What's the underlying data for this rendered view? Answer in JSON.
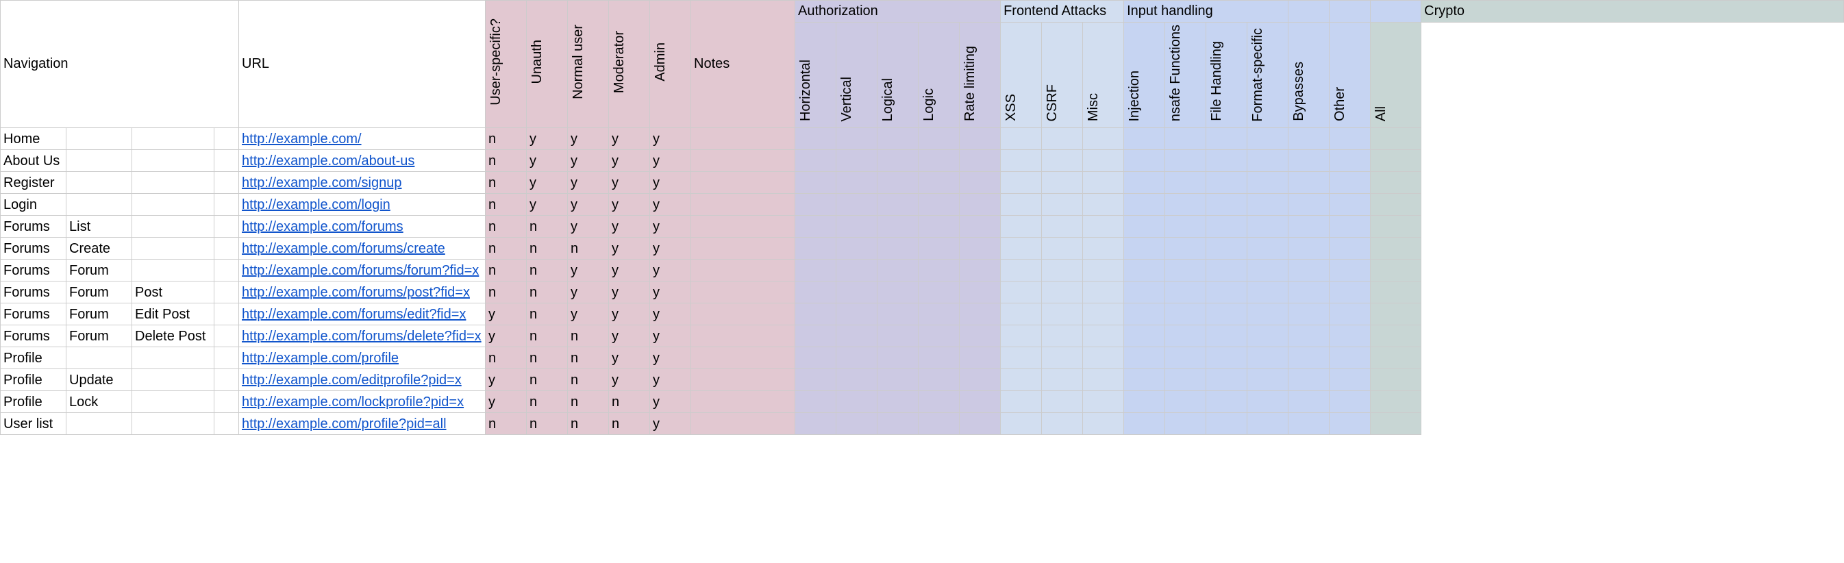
{
  "groups": {
    "authorization": "Authorization",
    "frontend": "Frontend Attacks",
    "input": "Input handling",
    "crypto": "Crypto"
  },
  "headers": {
    "navigation": "Navigation",
    "url": "URL",
    "user_specific": "User-specific?",
    "unauth": "Unauth",
    "normal_user": "Normal user",
    "moderator": "Moderator",
    "admin": "Admin",
    "notes": "Notes",
    "horizontal": "Horizontal",
    "vertical": "Vertical",
    "logical": "Logical",
    "logic": "Logic",
    "rate_limiting": "Rate limiting",
    "xss": "XSS",
    "csrf": "CSRF",
    "misc": "Misc",
    "injection": "Injection",
    "nsafe_functions": "nsafe Functions",
    "file_handling": "File Handling",
    "format_specific": "Format-specific",
    "bypasses": "Bypasses",
    "other": "Other",
    "all": "All"
  },
  "rows": [
    {
      "n0": "Home",
      "n1": "",
      "n2": "",
      "n3": "",
      "url": "http://example.com/",
      "us": "n",
      "ua": "y",
      "nu": "y",
      "mo": "y",
      "ad": "y"
    },
    {
      "n0": "About Us",
      "n1": "",
      "n2": "",
      "n3": "",
      "url": "http://example.com/about-us",
      "us": "n",
      "ua": "y",
      "nu": "y",
      "mo": "y",
      "ad": "y"
    },
    {
      "n0": "Register",
      "n1": "",
      "n2": "",
      "n3": "",
      "url": "http://example.com/signup",
      "us": "n",
      "ua": "y",
      "nu": "y",
      "mo": "y",
      "ad": "y"
    },
    {
      "n0": "Login",
      "n1": "",
      "n2": "",
      "n3": "",
      "url": "http://example.com/login",
      "us": "n",
      "ua": "y",
      "nu": "y",
      "mo": "y",
      "ad": "y"
    },
    {
      "n0": "Forums",
      "n1": "List",
      "n2": "",
      "n3": "",
      "url": "http://example.com/forums",
      "us": "n",
      "ua": "n",
      "nu": "y",
      "mo": "y",
      "ad": "y"
    },
    {
      "n0": "Forums",
      "n1": "Create",
      "n2": "",
      "n3": "",
      "url": "http://example.com/forums/create",
      "us": "n",
      "ua": "n",
      "nu": "n",
      "mo": "y",
      "ad": "y"
    },
    {
      "n0": "Forums",
      "n1": "Forum",
      "n2": "",
      "n3": "",
      "url": "http://example.com/forums/forum?fid=x",
      "us": "n",
      "ua": "n",
      "nu": "y",
      "mo": "y",
      "ad": "y"
    },
    {
      "n0": "Forums",
      "n1": "Forum",
      "n2": "Post",
      "n3": "",
      "url": "http://example.com/forums/post?fid=x",
      "us": "n",
      "ua": "n",
      "nu": "y",
      "mo": "y",
      "ad": "y"
    },
    {
      "n0": "Forums",
      "n1": "Forum",
      "n2": "Edit Post",
      "n3": "",
      "url": "http://example.com/forums/edit?fid=x",
      "us": "y",
      "ua": "n",
      "nu": "y",
      "mo": "y",
      "ad": "y"
    },
    {
      "n0": "Forums",
      "n1": "Forum",
      "n2": "Delete Post",
      "n3": "",
      "url": "http://example.com/forums/delete?fid=x",
      "us": "y",
      "ua": "n",
      "nu": "n",
      "mo": "y",
      "ad": "y"
    },
    {
      "n0": "Profile",
      "n1": "",
      "n2": "",
      "n3": "",
      "url": "http://example.com/profile",
      "us": "n",
      "ua": "n",
      "nu": "n",
      "mo": "y",
      "ad": "y"
    },
    {
      "n0": "Profile",
      "n1": "Update",
      "n2": "",
      "n3": "",
      "url": "http://example.com/editprofile?pid=x",
      "us": "y",
      "ua": "n",
      "nu": "n",
      "mo": "y",
      "ad": "y"
    },
    {
      "n0": "Profile",
      "n1": "Lock",
      "n2": "",
      "n3": "",
      "url": "http://example.com/lockprofile?pid=x",
      "us": "y",
      "ua": "n",
      "nu": "n",
      "mo": "n",
      "ad": "y"
    },
    {
      "n0": "User list",
      "n1": "",
      "n2": "",
      "n3": "",
      "url": "http://example.com/profile?pid=all",
      "us": "n",
      "ua": "n",
      "nu": "n",
      "mo": "n",
      "ad": "y"
    }
  ]
}
